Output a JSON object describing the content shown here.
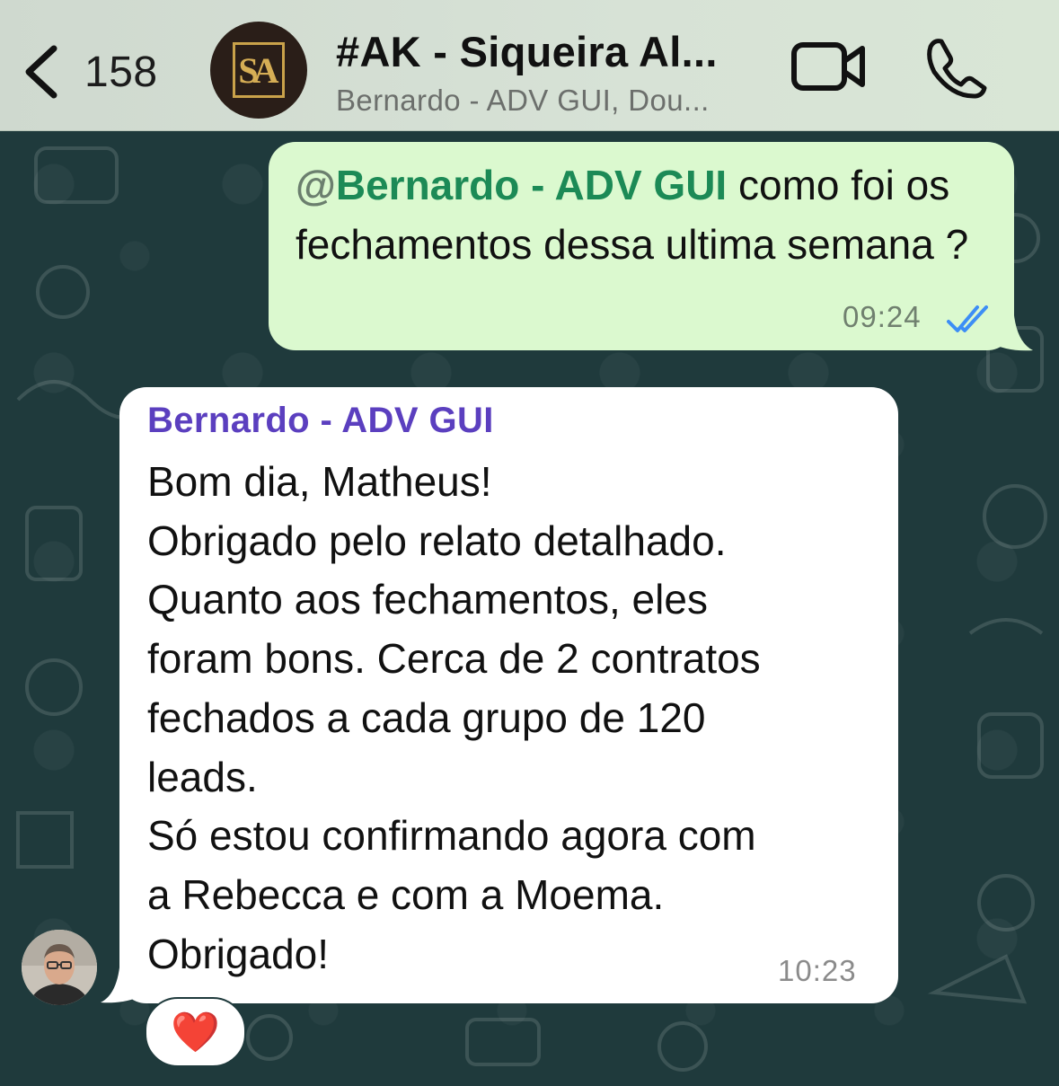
{
  "header": {
    "back_count": "158",
    "group_title": "#AK - Siqueira Al...",
    "group_subtitle": "Bernardo - ADV GUI, Dou...",
    "avatar_logo": "SA"
  },
  "messages": {
    "outgoing": {
      "mention": "Bernardo - ADV GUI",
      "at": "@",
      "text": " como foi os fechamentos dessa ultima semana ?",
      "time": "09:24",
      "status_icon": "double-check-read"
    },
    "incoming": {
      "sender": "Bernardo - ADV GUI",
      "text": "Bom dia, Matheus!\nObrigado pelo relato detalhado.\nQuanto aos fechamentos, eles\nforam bons. Cerca de 2 contratos\nfechados a cada grupo de 120\nleads.\nSó estou confirmando agora com\na Rebecca e com a Moema.\nObrigado!",
      "time": "10:23",
      "reaction": "❤️"
    }
  },
  "icons": {
    "back": "chevron-left-icon",
    "video": "video-camera-icon",
    "call": "phone-icon"
  },
  "colors": {
    "header_bg": "#d7e2d6",
    "chat_bg": "#1f3a3c",
    "outgoing_bubble": "#dbf9cf",
    "incoming_bubble": "#ffffff",
    "mention": "#1c8a56",
    "sender_name": "#5b3fbf",
    "read_ticks": "#3d8ef5"
  }
}
